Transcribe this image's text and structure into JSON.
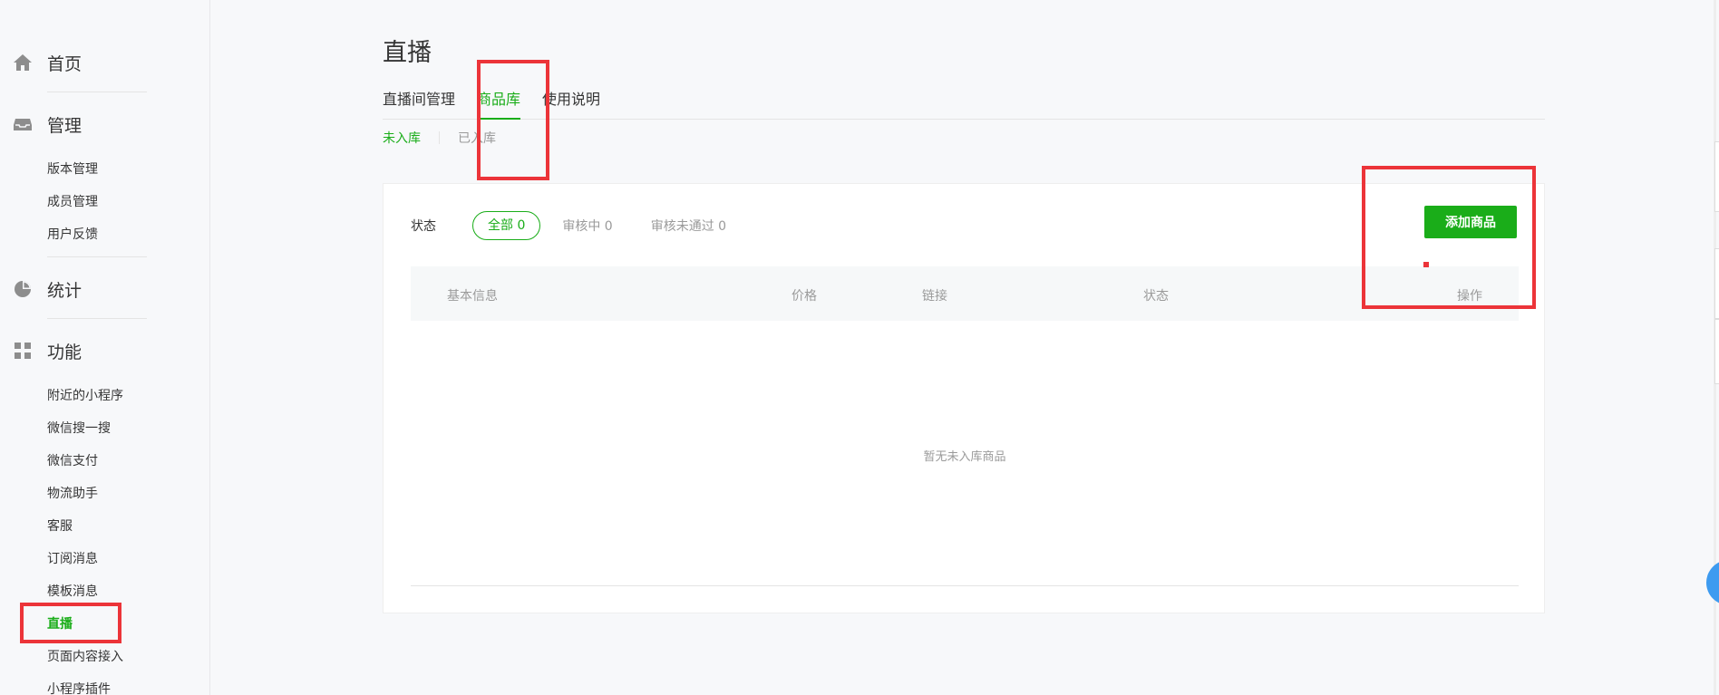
{
  "sidebar": {
    "home": {
      "label": "首页",
      "icon": "home-icon"
    },
    "manage": {
      "label": "管理",
      "icon": "inbox-icon",
      "items": [
        "版本管理",
        "成员管理",
        "用户反馈"
      ]
    },
    "stats": {
      "label": "统计",
      "icon": "pie-icon"
    },
    "features": {
      "label": "功能",
      "icon": "grid-icon",
      "items": [
        "附近的小程序",
        "微信搜一搜",
        "微信支付",
        "物流助手",
        "客服",
        "订阅消息",
        "模板消息",
        "直播",
        "页面内容接入",
        "小程序插件"
      ],
      "active": "直播"
    }
  },
  "main": {
    "title": "直播",
    "tabs": [
      {
        "label": "直播间管理",
        "active": false
      },
      {
        "label": "商品库",
        "active": true
      },
      {
        "label": "使用说明",
        "active": false
      }
    ],
    "subtabs": [
      {
        "label": "未入库",
        "active": true
      },
      {
        "label": "已入库",
        "active": false
      }
    ],
    "filter": {
      "label": "状态",
      "options": [
        "全部 0",
        "审核中 0",
        "审核未通过 0"
      ]
    },
    "add_button": "添加商品",
    "table": {
      "columns": [
        "基本信息",
        "价格",
        "链接",
        "状态",
        "操作"
      ],
      "empty_text": "暂无未入库商品"
    }
  },
  "colors": {
    "accent": "#1aad19",
    "annotation": "#ec3439",
    "muted": "#9a9a9a"
  }
}
